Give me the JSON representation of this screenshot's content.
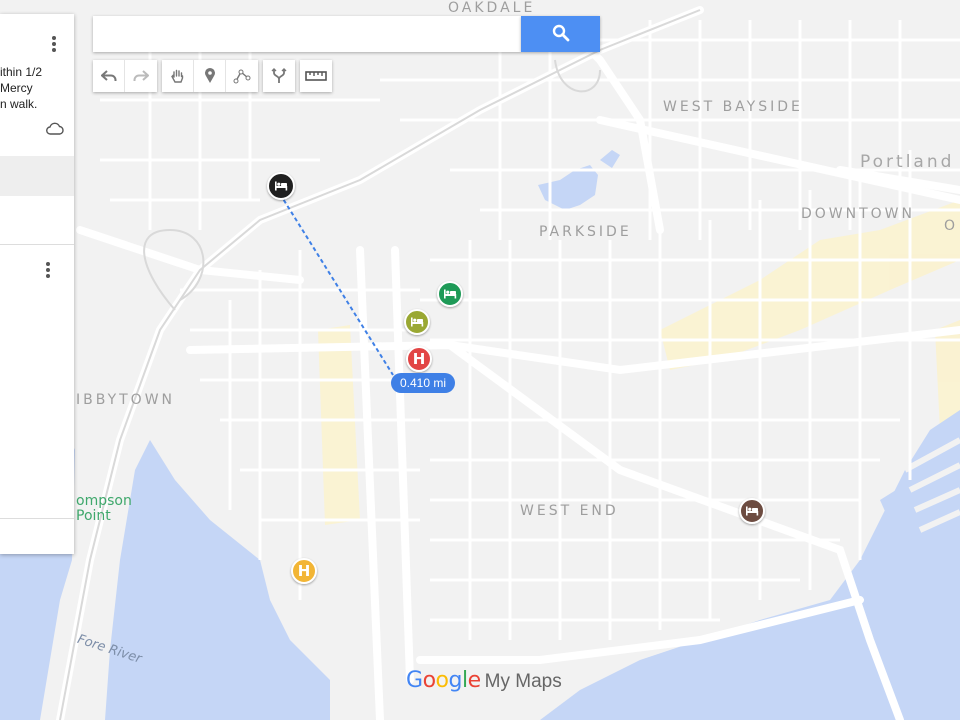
{
  "map": {
    "labels": {
      "oakdale": "OAKDALE",
      "west_bayside": "WEST BAYSIDE",
      "portland": "Portland",
      "downtown": "DOWNTOWN",
      "downtown_cut": "O",
      "parkside": "PARKSIDE",
      "libbytown": "IBBYTOWN",
      "thompson_point": [
        "ompson",
        "Point"
      ],
      "west_end": "WEST END",
      "fore_river": "Fore River"
    },
    "colors": {
      "water": "#c5d6f6",
      "road": "#ffffff",
      "land": "#f2f2f2",
      "park": "#fdf6d3"
    }
  },
  "panel": {
    "description_lines": [
      "ithin 1/2",
      "Mercy",
      "n walk."
    ],
    "icons": [
      "more-vert-icon",
      "cloud-icon",
      "more-vert-icon"
    ]
  },
  "search": {
    "value": "",
    "placeholder": ""
  },
  "toolbar": [
    "undo-icon",
    "redo-icon",
    "hand-icon",
    "pin-icon",
    "line-icon",
    "directions-icon",
    "ruler-icon"
  ],
  "markers": [
    {
      "kind": "lodging",
      "color": "#202020"
    },
    {
      "kind": "lodging",
      "color": "#1e9a57"
    },
    {
      "kind": "lodging",
      "color": "#9aa833"
    },
    {
      "kind": "hospital",
      "color": "#e24545",
      "label": "H"
    },
    {
      "kind": "hospital",
      "color": "#f2b535",
      "label": "H"
    },
    {
      "kind": "lodging",
      "color": "#6d4c41"
    }
  ],
  "measurement": {
    "distance": "0.410 mi"
  },
  "branding": {
    "google": "Google",
    "product": "My Maps"
  }
}
